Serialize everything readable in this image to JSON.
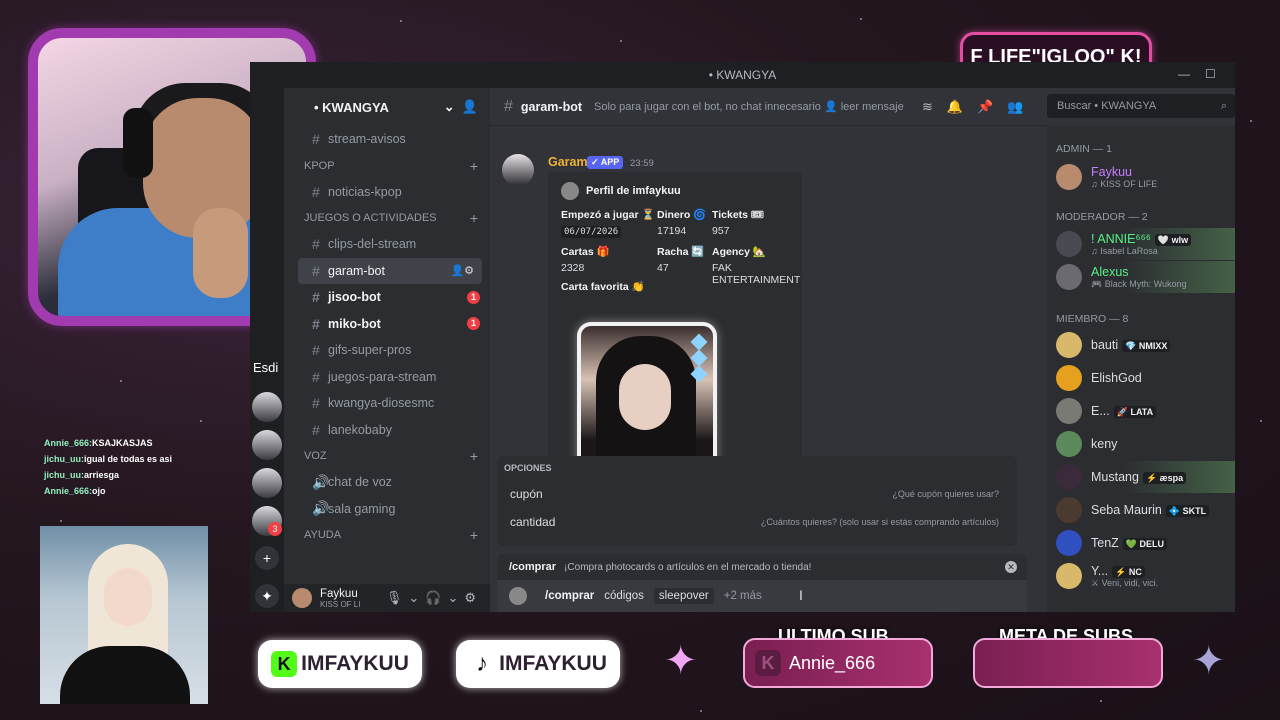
{
  "overlay": {
    "badge_text": "F LIFE\"IGLOO\"  K!",
    "chat_lines": [
      {
        "user": "Annie_666:",
        "text": "KSAJKASJAS"
      },
      {
        "user": "jichu_uu:",
        "text": "igual de todas es asi"
      },
      {
        "user": "jichu_uu:",
        "text": "arriesga"
      },
      {
        "user": "Annie_666:",
        "text": "ojo"
      }
    ],
    "kick_handle": "IMFAYKUU",
    "tiktok_handle": "IMFAYKUU",
    "last_sub_title": "ULTIMO SUB",
    "last_sub_value": "Annie_666",
    "goal_title": "META DE SUBS",
    "goal_value": ""
  },
  "window": {
    "title": "• KWANGYA",
    "minimize": "—",
    "maximize": "☐"
  },
  "rail": {
    "label": "Esdi",
    "badge": "3",
    "add": "+",
    "explore": "✦"
  },
  "server": {
    "name": "• KWANGYA",
    "channels_top": [
      {
        "name": "stream-avisos",
        "hash": "#"
      }
    ],
    "cat_kpop": "KPOP",
    "kpop_channels": [
      {
        "name": "noticias-kpop",
        "hash": "#"
      }
    ],
    "cat_games": "JUEGOS O ACTIVIDADES",
    "game_channels": [
      {
        "name": "clips-del-stream",
        "hash": "#",
        "style": "normal"
      },
      {
        "name": "garam-bot",
        "hash": "#",
        "style": "active"
      },
      {
        "name": "jisoo-bot",
        "hash": "#",
        "style": "bold",
        "badge": "1"
      },
      {
        "name": "miko-bot",
        "hash": "#",
        "style": "bold",
        "badge": "1"
      },
      {
        "name": "gifs-super-pros",
        "hash": "#",
        "style": "normal"
      },
      {
        "name": "juegos-para-stream",
        "hash": "#",
        "style": "normal"
      },
      {
        "name": "kwangya-diosesmc",
        "hash": "#",
        "style": "normal"
      },
      {
        "name": "lanekobaby",
        "hash": "#",
        "style": "normal"
      }
    ],
    "cat_voice": "VOZ",
    "voice_channels": [
      {
        "name": "chat de voz",
        "hash": "🔊"
      },
      {
        "name": "sala gaming",
        "hash": "🔊"
      }
    ],
    "cat_help": "AYUDA",
    "user_name": "Faykuu",
    "user_status": "KISS OF LI"
  },
  "chat": {
    "channel": "garam-bot",
    "topic": "Solo para jugar con el bot, no chat innecesario 👤 leer mensaje...",
    "author": "Garam",
    "app_tag": "✓ APP",
    "time": "23:59",
    "embed": {
      "title": "Perfil de imfaykuu",
      "f1_k": "Empezó a jugar ⏳",
      "f1_v": "06/07/2026",
      "f2_k": "Dinero 🌀",
      "f2_v": "17194",
      "f3_k": "Tickets 🎟",
      "f3_v": "957",
      "f4_k": "Cartas 🎁",
      "f4_v": "2328",
      "f5_k": "Racha 🔄",
      "f5_v": "47",
      "f6_k": "Agency 🏡",
      "f6_v": "FAK ENTERTAINMENT",
      "fav": "Carta favorita 👏"
    },
    "options_title": "OPCIONES",
    "options": [
      {
        "name": "cupón",
        "desc": "¿Qué cupón quieres usar?"
      },
      {
        "name": "cantidad",
        "desc": "¿Cuántos quieres? (solo usar si estás comprando artículos)"
      }
    ],
    "command_name": "/comprar",
    "command_desc": "¡Compra photocards o artículos en el mercado o tienda!",
    "input_cmd": "/comprar",
    "input_param1": "códigos",
    "input_param2": "sleepover",
    "input_more": "+2 más",
    "search_placeholder": "Buscar • KWANGYA"
  },
  "members": {
    "admin_label": "ADMIN — 1",
    "mod_label": "MODERADOR — 2",
    "member_label": "MIEMBRO — 8",
    "admins": [
      {
        "name": "Faykuu",
        "sub": "♫ KISS OF LIFE",
        "color": "#c77dff"
      }
    ],
    "mods": [
      {
        "name": "! ANNIE⁶⁶⁶",
        "tag": "🤍 wlw",
        "sub": "♫ Isabel LaRosa",
        "color": "#57f287"
      },
      {
        "name": "Alexus",
        "tag": "",
        "sub": "🎮 Black Myth: Wukong",
        "color": "#57f287"
      }
    ],
    "regular": [
      {
        "name": "bauti",
        "tag": "💎 NMIXX",
        "sub": ""
      },
      {
        "name": "ElishGod",
        "tag": "",
        "sub": ""
      },
      {
        "name": "E...",
        "tag": "🚀 LATA",
        "sub": ""
      },
      {
        "name": "keny",
        "tag": "",
        "sub": ""
      },
      {
        "name": "Mustang",
        "tag": "⚡ æspa",
        "sub": ""
      },
      {
        "name": "Seba Maurin",
        "tag": "💠 SKTL",
        "sub": ""
      },
      {
        "name": "TenZ",
        "tag": "💚 DELU",
        "sub": ""
      },
      {
        "name": "Y...",
        "tag": "⚡ NC",
        "sub": "⚔ Veni, vidi, vici."
      }
    ]
  },
  "colors": {
    "accent": "#5865f2",
    "bot_name": "#f0b232",
    "frame": "#a23bb0"
  }
}
